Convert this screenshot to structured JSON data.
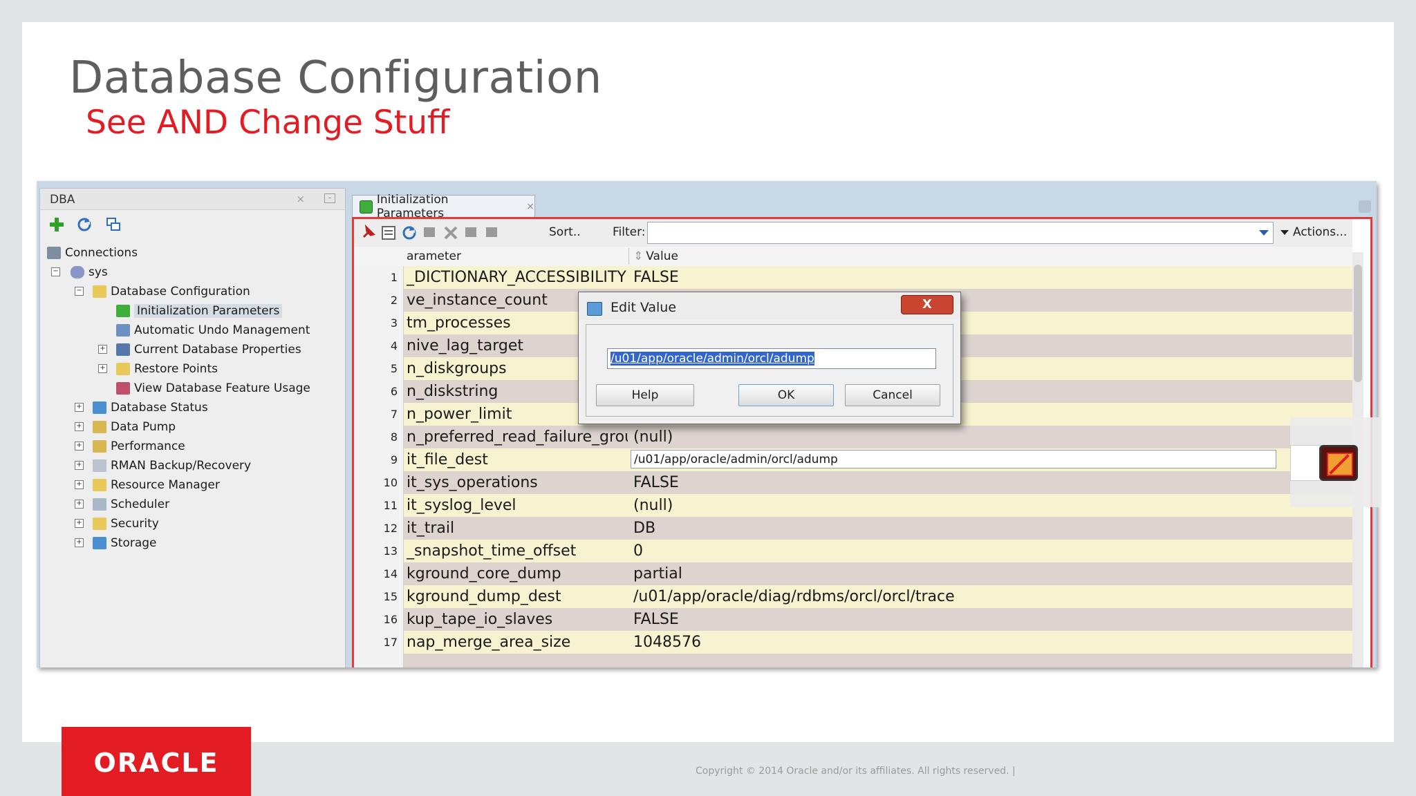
{
  "slide": {
    "title": "Database Configuration",
    "subtitle": "See AND Change Stuff",
    "copyright": "Copyright © 2014 Oracle and/or its affiliates. All rights reserved.  |",
    "logo_text": "ORACLE"
  },
  "dba_panel": {
    "title": "DBA",
    "close_glyph": "×",
    "tree": {
      "connections": "Connections",
      "sys": "sys",
      "database_configuration": "Database Configuration",
      "initialization_parameters": "Initialization Parameters",
      "automatic_undo_management": "Automatic Undo Management",
      "current_database_properties": "Current Database Properties",
      "restore_points": "Restore Points",
      "view_database_feature_usage": "View Database Feature Usage",
      "database_status": "Database Status",
      "data_pump": "Data Pump",
      "performance": "Performance",
      "rman_backup_recovery": "RMAN Backup/Recovery",
      "resource_manager": "Resource Manager",
      "scheduler": "Scheduler",
      "security": "Security",
      "storage": "Storage"
    }
  },
  "editor": {
    "tab_label": "Initialization Parameters",
    "tab_close": "×",
    "toolbar": {
      "sort_label": "Sort..",
      "filter_label": "Filter:",
      "filter_value": "",
      "actions_label": "Actions..."
    },
    "columns": {
      "parameter": "arameter",
      "value": "Value"
    },
    "rows": [
      {
        "num": "1",
        "name": "_DICTIONARY_ACCESSIBILITY",
        "value": "FALSE"
      },
      {
        "num": "2",
        "name": "ve_instance_count",
        "value": ""
      },
      {
        "num": "3",
        "name": "tm_processes",
        "value": ""
      },
      {
        "num": "4",
        "name": "nive_lag_target",
        "value": ""
      },
      {
        "num": "5",
        "name": "n_diskgroups",
        "value": ""
      },
      {
        "num": "6",
        "name": "n_diskstring",
        "value": ""
      },
      {
        "num": "7",
        "name": "n_power_limit",
        "value": ""
      },
      {
        "num": "8",
        "name": "n_preferred_read_failure_groups",
        "value": "(null)"
      },
      {
        "num": "9",
        "name": "it_file_dest",
        "value": "/u01/app/oracle/admin/orcl/adump"
      },
      {
        "num": "10",
        "name": "it_sys_operations",
        "value": "FALSE"
      },
      {
        "num": "11",
        "name": "it_syslog_level",
        "value": "(null)"
      },
      {
        "num": "12",
        "name": "it_trail",
        "value": "DB"
      },
      {
        "num": "13",
        "name": "_snapshot_time_offset",
        "value": "0"
      },
      {
        "num": "14",
        "name": "kground_core_dump",
        "value": "partial"
      },
      {
        "num": "15",
        "name": "kground_dump_dest",
        "value": "/u01/app/oracle/diag/rdbms/orcl/orcl/trace"
      },
      {
        "num": "16",
        "name": "kup_tape_io_slaves",
        "value": "FALSE"
      },
      {
        "num": "17",
        "name": "nap_merge_area_size",
        "value": "1048576"
      }
    ]
  },
  "dialog": {
    "title": "Edit Value",
    "close_glyph": "X",
    "input_value": "/u01/app/oracle/admin/orcl/adump",
    "help_label": "Help",
    "ok_label": "OK",
    "cancel_label": "Cancel"
  },
  "colors": {
    "accent_red": "#e31b23",
    "row_yellow": "#f7f2cf",
    "row_mauve": "#ddd4d0"
  }
}
